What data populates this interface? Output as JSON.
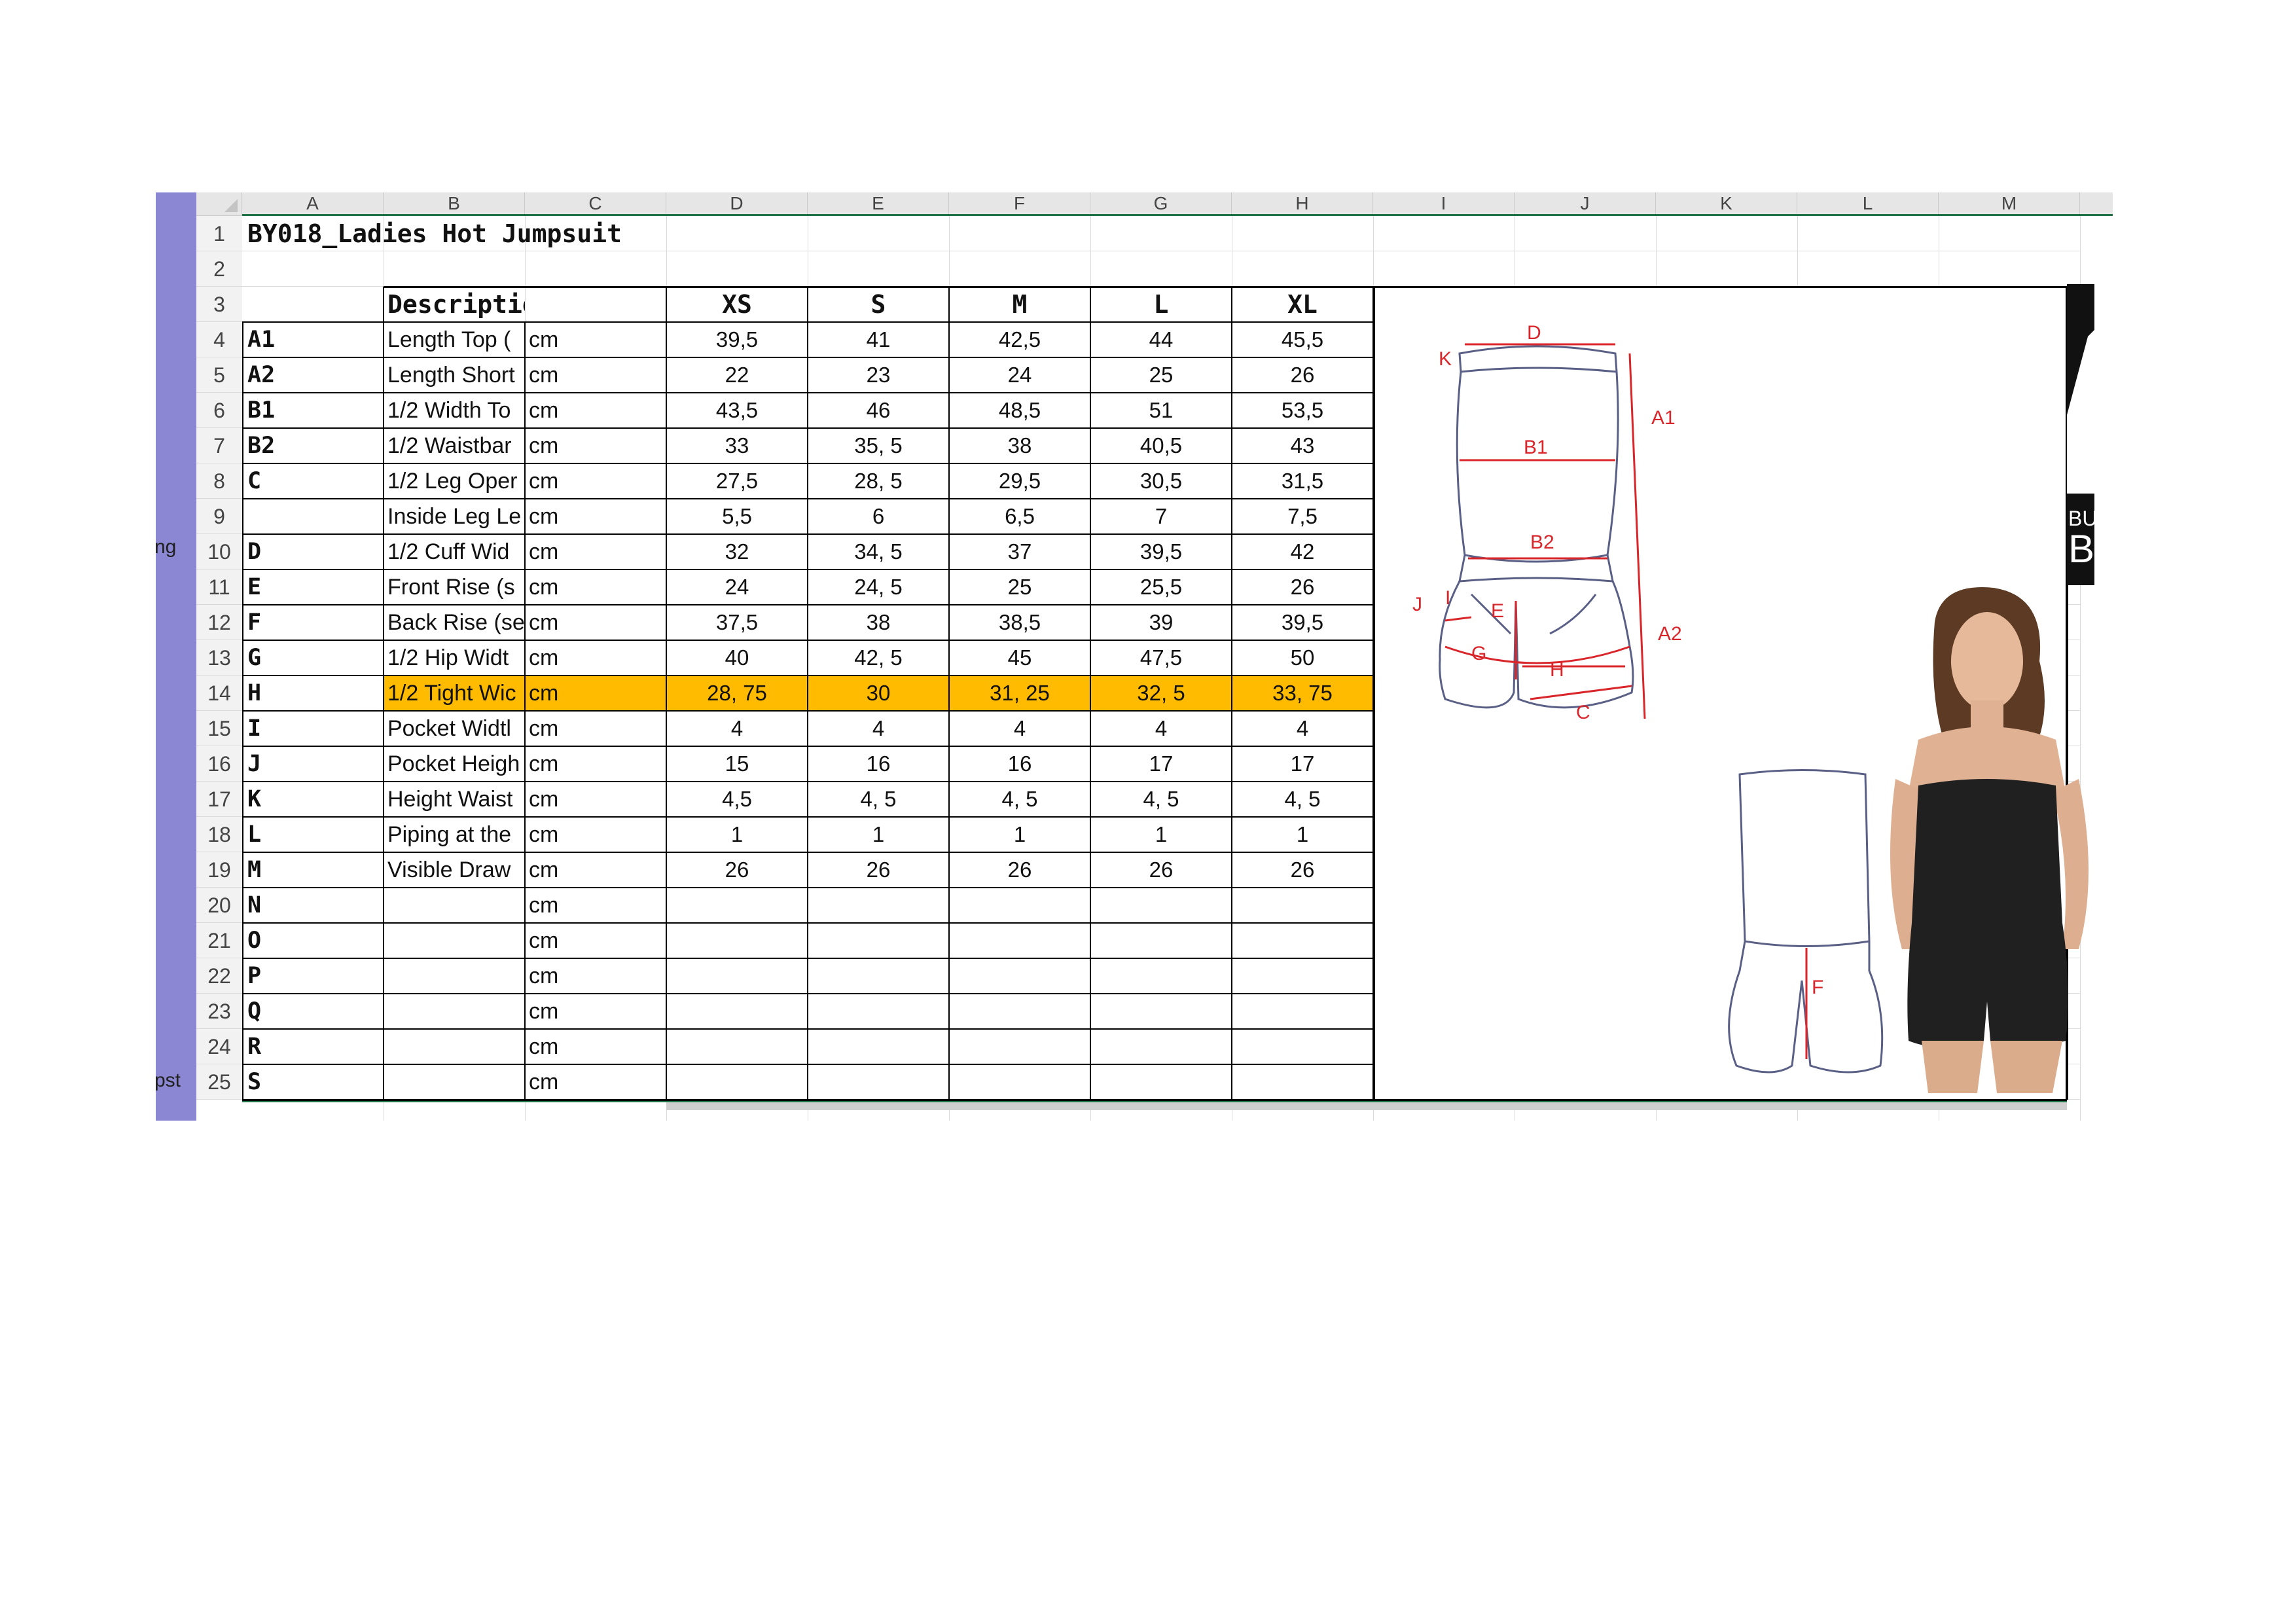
{
  "sidebar": {
    "fragments": [
      "ng",
      "pst"
    ]
  },
  "columns": [
    "A",
    "B",
    "C",
    "D",
    "E",
    "F",
    "G",
    "H",
    "I",
    "J",
    "K",
    "L",
    "M"
  ],
  "rows": [
    "1",
    "2",
    "3",
    "4",
    "5",
    "6",
    "7",
    "8",
    "9",
    "10",
    "11",
    "12",
    "13",
    "14",
    "15",
    "16",
    "17",
    "18",
    "19",
    "20",
    "21",
    "22",
    "23",
    "24",
    "25"
  ],
  "title": "BY018_Ladies Hot Jumpsuit",
  "header": {
    "description": "Description",
    "sizes": [
      "XS",
      "S",
      "M",
      "L",
      "XL"
    ]
  },
  "measurements": [
    {
      "code": "A1",
      "desc": "Length Top (",
      "unit": "cm",
      "values": [
        "39,5",
        "41",
        "42,5",
        "44",
        "45,5"
      ]
    },
    {
      "code": "A2",
      "desc": "Length Short",
      "unit": "cm",
      "values": [
        "22",
        "23",
        "24",
        "25",
        "26"
      ]
    },
    {
      "code": "B1",
      "desc": "1/2  Width To",
      "unit": "cm",
      "values": [
        "43,5",
        "46",
        "48,5",
        "51",
        "53,5"
      ]
    },
    {
      "code": "B2",
      "desc": "1/2 Waistbar",
      "unit": "cm",
      "values": [
        "33",
        "35, 5",
        "38",
        "40,5",
        "43"
      ]
    },
    {
      "code": "C",
      "desc": "1/2 Leg Oper",
      "unit": "cm",
      "values": [
        "27,5",
        "28, 5",
        "29,5",
        "30,5",
        "31,5"
      ]
    },
    {
      "code": "",
      "desc": "Inside Leg Le",
      "unit": "cm",
      "values": [
        "5,5",
        "6",
        "6,5",
        "7",
        "7,5"
      ]
    },
    {
      "code": "D",
      "desc": "1/2 Cuff Wid",
      "unit": "cm",
      "values": [
        "32",
        "34, 5",
        "37",
        "39,5",
        "42"
      ]
    },
    {
      "code": "E",
      "desc": "Front Rise (s",
      "unit": "cm",
      "values": [
        "24",
        "24, 5",
        "25",
        "25,5",
        "26"
      ]
    },
    {
      "code": "F",
      "desc": "Back Rise (se",
      "unit": "cm",
      "values": [
        "37,5",
        "38",
        "38,5",
        "39",
        "39,5"
      ]
    },
    {
      "code": "G",
      "desc": "1/2 Hip Widt",
      "unit": "cm",
      "values": [
        "40",
        "42, 5",
        "45",
        "47,5",
        "50"
      ]
    },
    {
      "code": "H",
      "desc": "1/2 Tight Wic",
      "unit": "cm",
      "values": [
        "28, 75",
        "30",
        "31, 25",
        "32, 5",
        "33, 75"
      ]
    },
    {
      "code": "I",
      "desc": "Pocket Widtl",
      "unit": "cm",
      "values": [
        "4",
        "4",
        "4",
        "4",
        "4"
      ]
    },
    {
      "code": "J",
      "desc": "Pocket Heigh",
      "unit": "cm",
      "values": [
        "15",
        "16",
        "16",
        "17",
        "17"
      ]
    },
    {
      "code": "K",
      "desc": "Height Waist",
      "unit": "cm",
      "values": [
        "4,5",
        "4, 5",
        "4, 5",
        "4, 5",
        "4, 5"
      ]
    },
    {
      "code": "L",
      "desc": "Piping at the",
      "unit": "cm",
      "values": [
        "1",
        "1",
        "1",
        "1",
        "1"
      ]
    },
    {
      "code": "M",
      "desc": "Visible Draw",
      "unit": "cm",
      "values": [
        "26",
        "26",
        "26",
        "26",
        "26"
      ]
    },
    {
      "code": "N",
      "desc": "",
      "unit": "cm",
      "values": [
        "",
        "",
        "",
        "",
        ""
      ]
    },
    {
      "code": "O",
      "desc": "",
      "unit": "cm",
      "values": [
        "",
        "",
        "",
        "",
        ""
      ]
    },
    {
      "code": "P",
      "desc": "",
      "unit": "cm",
      "values": [
        "",
        "",
        "",
        "",
        ""
      ]
    },
    {
      "code": "Q",
      "desc": "",
      "unit": "cm",
      "values": [
        "",
        "",
        "",
        "",
        ""
      ]
    },
    {
      "code": "R",
      "desc": "",
      "unit": "cm",
      "values": [
        "",
        "",
        "",
        "",
        ""
      ]
    },
    {
      "code": "S",
      "desc": "",
      "unit": "cm",
      "values": [
        "",
        "",
        "",
        "",
        ""
      ]
    }
  ],
  "highlight_row": 14,
  "highlight_color": "#ffbb00",
  "sketch_labels": [
    "D",
    "K",
    "A1",
    "B1",
    "B2",
    "J",
    "I",
    "E",
    "G",
    "A2",
    "H",
    "C",
    "F"
  ],
  "brand_text": "BU",
  "brand_text2": "BF",
  "colors": {
    "sidebar": "#8b87d2",
    "grid_accent": "#217346",
    "sketch_red": "#d9262b"
  }
}
